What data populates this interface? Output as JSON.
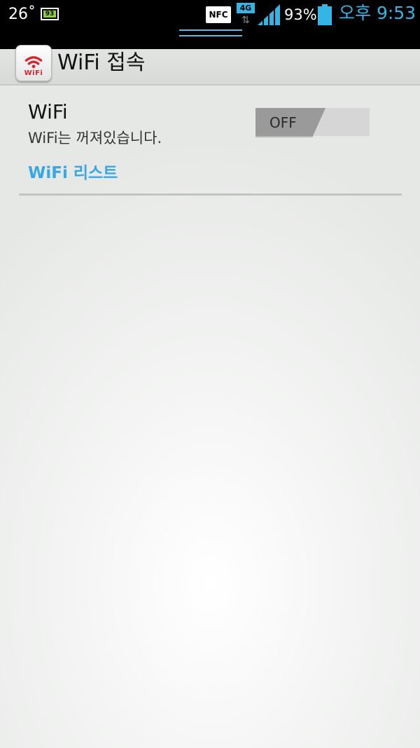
{
  "status_bar": {
    "temperature": "26˚",
    "battery_small_level": "93",
    "nfc": "NFC",
    "network_type": "4G",
    "network_arrows": "⇅",
    "battery_percent": "93%",
    "time": "오후 9:53",
    "colors": {
      "accent": "#35b5e5",
      "battery_small": "#8ccf3c"
    }
  },
  "action_bar": {
    "app_icon_label": "WiFi",
    "title": "WiFi 접속"
  },
  "wifi_setting": {
    "title": "WiFi",
    "status": "WiFi는 꺼져있습니다.",
    "toggle_label": "OFF",
    "toggle_on": false
  },
  "wifi_list_link": "WiFi 리스트",
  "icons": {
    "signal": "cellular-signal-icon",
    "battery": "battery-icon",
    "app": "wifi-app-icon"
  }
}
